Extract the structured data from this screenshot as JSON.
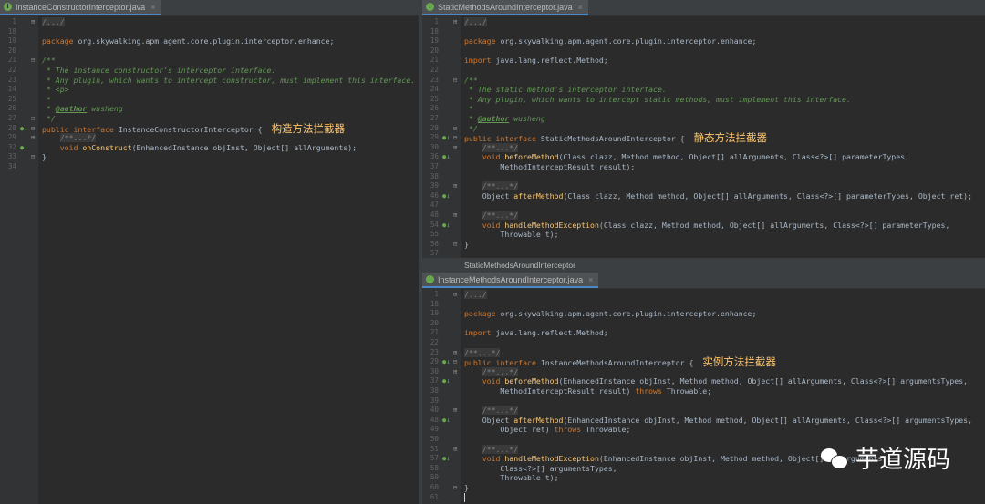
{
  "left_pane": {
    "tab": "InstanceConstructorInterceptor.java",
    "lines": [
      {
        "n": "1",
        "code": "/.../",
        "cls": "fold-text"
      },
      {
        "n": "18",
        "code": ""
      },
      {
        "n": "19",
        "code": "package org.skywalking.apm.agent.core.plugin.interceptor.enhance;"
      },
      {
        "n": "20",
        "code": ""
      },
      {
        "n": "21",
        "code": "/**",
        "cls": "cm"
      },
      {
        "n": "22",
        "code": " * The instance constructor's interceptor interface.",
        "cls": "cm"
      },
      {
        "n": "23",
        "code": " * Any plugin, which wants to intercept constructor, must implement this interface.",
        "cls": "cm"
      },
      {
        "n": "24",
        "code": " * <p>",
        "cls": "cm"
      },
      {
        "n": "25",
        "code": " *",
        "cls": "cm"
      },
      {
        "n": "26",
        "code": " * @author wusheng",
        "cls": "cm"
      },
      {
        "n": "27",
        "code": " */",
        "cls": "cm"
      },
      {
        "n": "28",
        "code": "public interface InstanceConstructorInterceptor {",
        "annotation": "构造方法拦截器"
      },
      {
        "n": "29",
        "code": "    /**...*/",
        "cls": "fold-text"
      },
      {
        "n": "32",
        "code": "    void onConstruct(EnhancedInstance objInst, Object[] allArguments);"
      },
      {
        "n": "33",
        "code": "}"
      },
      {
        "n": "34",
        "code": ""
      }
    ]
  },
  "right_top_pane": {
    "tab": "StaticMethodsAroundInterceptor.java",
    "lines": [
      {
        "n": "1",
        "code": "/.../",
        "cls": "fold-text"
      },
      {
        "n": "18",
        "code": ""
      },
      {
        "n": "19",
        "code": "package org.skywalking.apm.agent.core.plugin.interceptor.enhance;"
      },
      {
        "n": "20",
        "code": ""
      },
      {
        "n": "21",
        "code": "import java.lang.reflect.Method;"
      },
      {
        "n": "22",
        "code": ""
      },
      {
        "n": "23",
        "code": "/**",
        "cls": "cm"
      },
      {
        "n": "24",
        "code": " * The static method's interceptor interface.",
        "cls": "cm"
      },
      {
        "n": "25",
        "code": " * Any plugin, which wants to intercept static methods, must implement this interface.",
        "cls": "cm"
      },
      {
        "n": "26",
        "code": " *",
        "cls": "cm"
      },
      {
        "n": "27",
        "code": " * @author wusheng",
        "cls": "cm"
      },
      {
        "n": "28",
        "code": " */",
        "cls": "cm"
      },
      {
        "n": "29",
        "code": "public interface StaticMethodsAroundInterceptor {",
        "annotation": "静态方法拦截器"
      },
      {
        "n": "30",
        "code": "    /**...*/",
        "cls": "fold-text"
      },
      {
        "n": "36",
        "code": "    void beforeMethod(Class clazz, Method method, Object[] allArguments, Class<?>[] parameterTypes,"
      },
      {
        "n": "37",
        "code": "        MethodInterceptResult result);"
      },
      {
        "n": "38",
        "code": ""
      },
      {
        "n": "39",
        "code": "    /**...*/",
        "cls": "fold-text"
      },
      {
        "n": "46",
        "code": "    Object afterMethod(Class clazz, Method method, Object[] allArguments, Class<?>[] parameterTypes, Object ret);"
      },
      {
        "n": "47",
        "code": ""
      },
      {
        "n": "48",
        "code": "    /**...*/",
        "cls": "fold-text"
      },
      {
        "n": "54",
        "code": "    void handleMethodException(Class clazz, Method method, Object[] allArguments, Class<?>[] parameterTypes,"
      },
      {
        "n": "55",
        "code": "        Throwable t);"
      },
      {
        "n": "56",
        "code": "}"
      },
      {
        "n": "57",
        "code": ""
      }
    ],
    "breadcrumb": "StaticMethodsAroundInterceptor"
  },
  "right_bottom_pane": {
    "tab": "InstanceMethodsAroundInterceptor.java",
    "lines": [
      {
        "n": "1",
        "code": "/.../",
        "cls": "fold-text"
      },
      {
        "n": "18",
        "code": ""
      },
      {
        "n": "19",
        "code": "package org.skywalking.apm.agent.core.plugin.interceptor.enhance;"
      },
      {
        "n": "20",
        "code": ""
      },
      {
        "n": "21",
        "code": "import java.lang.reflect.Method;"
      },
      {
        "n": "22",
        "code": ""
      },
      {
        "n": "23",
        "code": "/**...*/",
        "cls": "fold-text"
      },
      {
        "n": "29",
        "code": "public interface InstanceMethodsAroundInterceptor {",
        "annotation": "实例方法拦截器"
      },
      {
        "n": "30",
        "code": "    /**...*/",
        "cls": "fold-text"
      },
      {
        "n": "37",
        "code": "    void beforeMethod(EnhancedInstance objInst, Method method, Object[] allArguments, Class<?>[] argumentsTypes,"
      },
      {
        "n": "38",
        "code": "        MethodInterceptResult result) throws Throwable;"
      },
      {
        "n": "39",
        "code": ""
      },
      {
        "n": "40",
        "code": "    /**...*/",
        "cls": "fold-text"
      },
      {
        "n": "48",
        "code": "    Object afterMethod(EnhancedInstance objInst, Method method, Object[] allArguments, Class<?>[] argumentsTypes,"
      },
      {
        "n": "49",
        "code": "        Object ret) throws Throwable;"
      },
      {
        "n": "50",
        "code": ""
      },
      {
        "n": "51",
        "code": "    /**...*/",
        "cls": "fold-text"
      },
      {
        "n": "57",
        "code": "    void handleMethodException(EnhancedInstance objInst, Method method, Object[] allArguments,"
      },
      {
        "n": "58",
        "code": "        Class<?>[] argumentsTypes,"
      },
      {
        "n": "59",
        "code": "        Throwable t);"
      },
      {
        "n": "60",
        "code": "}"
      },
      {
        "n": "61",
        "code": ""
      }
    ]
  },
  "watermark": {
    "text": "芋道源码",
    "icon": "wechat-icon"
  },
  "colors": {
    "keyword": "#cc7832",
    "comment": "#629755",
    "method": "#ffc66d",
    "text": "#a9b7c6",
    "background": "#2b2b2b"
  }
}
